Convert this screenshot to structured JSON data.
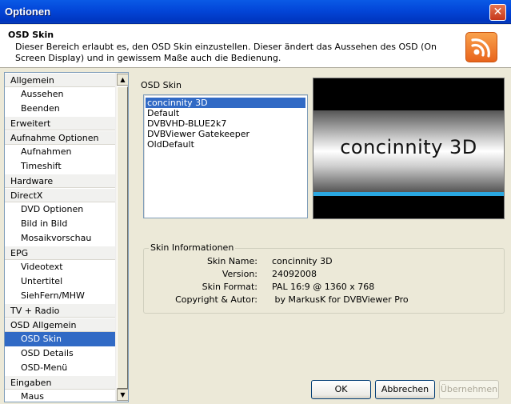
{
  "window": {
    "title": "Optionen",
    "close_glyph": "✕"
  },
  "header": {
    "title": "OSD Skin",
    "description": "Dieser Bereich erlaubt es, den OSD Skin einzustellen. Dieser ändert das Aussehen des OSD (On Screen Display) und in gewissem Maße auch die Bedienung.",
    "icon": "rss-feed-icon"
  },
  "nav": {
    "items": [
      {
        "label": "Allgemein",
        "type": "cat"
      },
      {
        "label": "Aussehen",
        "type": "sub"
      },
      {
        "label": "Beenden",
        "type": "sub"
      },
      {
        "label": "Erweitert",
        "type": "cat"
      },
      {
        "label": "Aufnahme Optionen",
        "type": "cat"
      },
      {
        "label": "Aufnahmen",
        "type": "sub"
      },
      {
        "label": "Timeshift",
        "type": "sub"
      },
      {
        "label": "Hardware",
        "type": "cat"
      },
      {
        "label": "DirectX",
        "type": "cat"
      },
      {
        "label": "DVD Optionen",
        "type": "sub"
      },
      {
        "label": "Bild in Bild",
        "type": "sub"
      },
      {
        "label": "Mosaikvorschau",
        "type": "sub"
      },
      {
        "label": "EPG",
        "type": "cat"
      },
      {
        "label": "Videotext",
        "type": "sub"
      },
      {
        "label": "Untertitel",
        "type": "sub"
      },
      {
        "label": "SiehFern/MHW",
        "type": "sub"
      },
      {
        "label": "TV + Radio",
        "type": "cat"
      },
      {
        "label": "OSD Allgemein",
        "type": "cat"
      },
      {
        "label": "OSD Skin",
        "type": "sub",
        "selected": true
      },
      {
        "label": "OSD Details",
        "type": "sub"
      },
      {
        "label": "OSD-Menü",
        "type": "sub"
      },
      {
        "label": "Eingaben",
        "type": "cat"
      },
      {
        "label": "Maus",
        "type": "sub"
      }
    ],
    "scroll_up": "▲",
    "scroll_down": "▼"
  },
  "skins": {
    "label": "OSD Skin",
    "items": [
      "concinnity 3D",
      "Default",
      "DVBVHD-BLUE2k7",
      "DVBViewer Gatekeeper",
      "OldDefault"
    ],
    "selected_index": 0,
    "preview_text": "concinnity 3D"
  },
  "info": {
    "legend": "Skin Informationen",
    "rows": [
      {
        "key": "Skin Name:",
        "value": "concinnity 3D"
      },
      {
        "key": "Version:",
        "value": "24092008"
      },
      {
        "key": "Skin Format:",
        "value": "PAL 16:9 @ 1360 x 768"
      },
      {
        "key": "Copyright & Autor:",
        "value": " by MarkusK for DVBViewer Pro"
      }
    ]
  },
  "buttons": {
    "ok": "OK",
    "cancel": "Abbrechen",
    "apply": "Übernehmen"
  }
}
